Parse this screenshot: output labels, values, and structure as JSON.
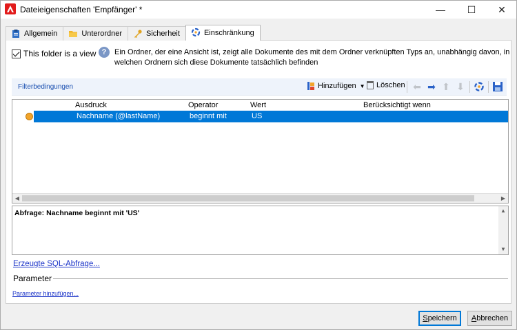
{
  "window": {
    "title": "Dateieigenschaften 'Empfänger' *",
    "controls": [
      "—",
      "☐",
      "✕"
    ]
  },
  "tabs": [
    {
      "label": "Allgemein",
      "icon": "clipboard-icon"
    },
    {
      "label": "Unterordner",
      "icon": "folder-icon"
    },
    {
      "label": "Sicherheit",
      "icon": "key-icon"
    },
    {
      "label": "Einschränkung",
      "icon": "restriction-icon",
      "active": true
    }
  ],
  "view": {
    "checkbox_label": "This folder is a view",
    "checked": true,
    "info_text": "Ein Ordner, der eine Ansicht ist, zeigt alle Dokumente des mit dem Ordner verknüpften Typs an, unabhängig davon, in welchen Ordnern sich diese Dokumente tatsächlich befinden"
  },
  "filter": {
    "title": "Filterbedingungen",
    "add_label": "Hinzufügen",
    "delete_label": "Löschen"
  },
  "grid": {
    "columns": [
      "Ausdruck",
      "Operator",
      "Wert",
      "Berücksichtigt wenn"
    ],
    "rows": [
      {
        "expression": "Nachname (@lastName)",
        "operator": "beginnt mit",
        "value": "US",
        "condition": ""
      }
    ]
  },
  "query": {
    "text": "Abfrage: Nachname beginnt mit 'US'"
  },
  "links": {
    "sql": "Erzeugte SQL-Abfrage...",
    "parameter_title": "Parameter",
    "parameter_add": "Parameter hinzufügen..."
  },
  "buttons": {
    "save": "Speichern",
    "cancel": "Abbrechen"
  },
  "colors": {
    "selection": "#0078d7",
    "link": "#1a33c8",
    "accent_blue": "#2a62c8",
    "status_dot": "#f2a42a"
  }
}
